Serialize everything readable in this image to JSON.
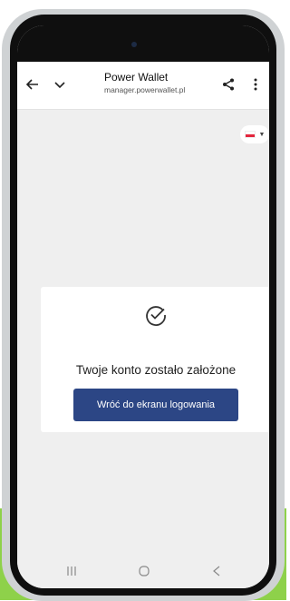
{
  "browser": {
    "title": "Power Wallet",
    "url": "manager.powerwallet.pl",
    "icons": {
      "back": "arrow-left-icon",
      "collapse": "chevron-down-icon",
      "share": "share-icon",
      "menu": "more-vert-icon"
    }
  },
  "language": {
    "flag": "poland-flag-icon",
    "caret": "caret-down-icon"
  },
  "card": {
    "icon": "check-circle-icon",
    "message": "Twoje konto zostało założone",
    "button_label": "Wróć do ekranu logowania"
  },
  "navbar": {
    "icons": [
      "recents-icon",
      "home-icon",
      "back-icon"
    ]
  },
  "colors": {
    "accent": "#2c4685",
    "background": "#efefef",
    "deco_green": "#8ed14a"
  }
}
